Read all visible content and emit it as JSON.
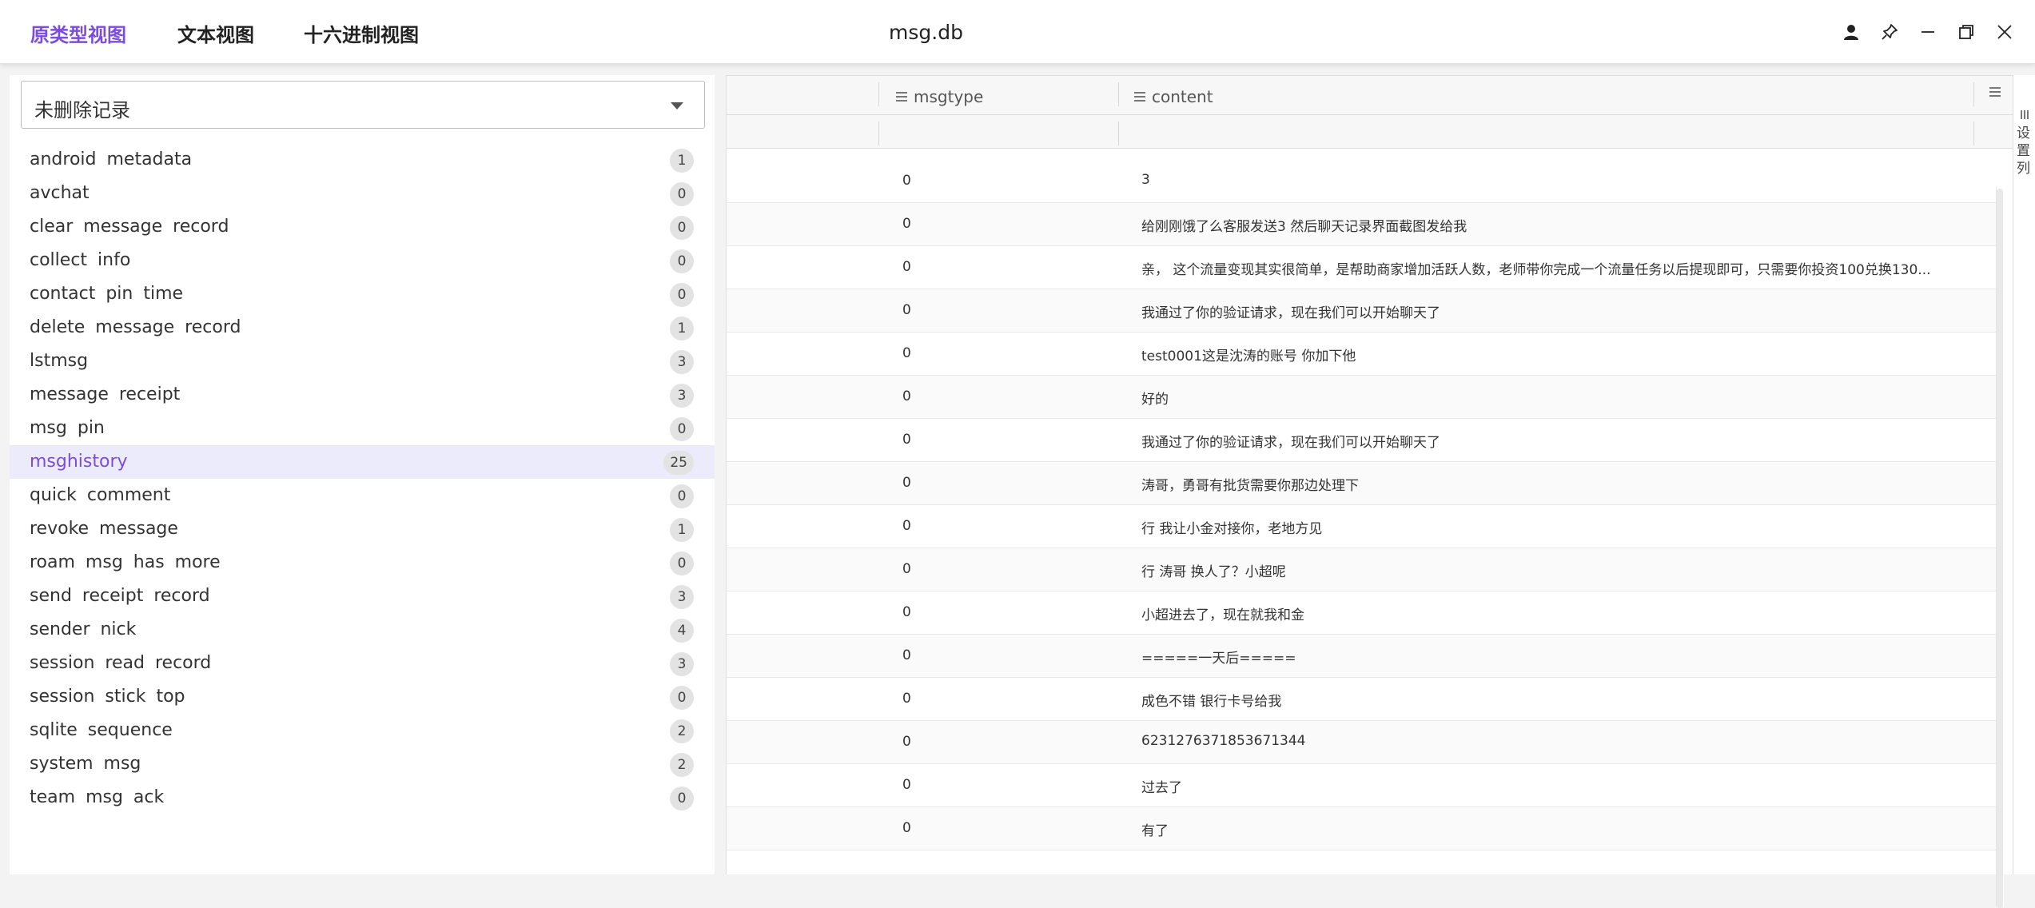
{
  "titlebar": {
    "tabs": [
      {
        "label": "原类型视图",
        "active": true
      },
      {
        "label": "文本视图",
        "active": false
      },
      {
        "label": "十六进制视图",
        "active": false
      }
    ],
    "title": "msg.db",
    "icons": [
      "user-icon",
      "pin-icon",
      "minimize-icon",
      "restore-icon",
      "close-icon"
    ]
  },
  "filter": {
    "selected": "未删除记录"
  },
  "tables": [
    {
      "name": "android metadata",
      "count": "1"
    },
    {
      "name": "avchat",
      "count": "0"
    },
    {
      "name": "clear message record",
      "count": "0"
    },
    {
      "name": "collect info",
      "count": "0"
    },
    {
      "name": "contact pin time",
      "count": "0"
    },
    {
      "name": "delete message record",
      "count": "1"
    },
    {
      "name": "lstmsg",
      "count": "3"
    },
    {
      "name": "message receipt",
      "count": "3"
    },
    {
      "name": "msg pin",
      "count": "0"
    },
    {
      "name": "msghistory",
      "count": "25",
      "selected": true
    },
    {
      "name": "quick comment",
      "count": "0"
    },
    {
      "name": "revoke message",
      "count": "1"
    },
    {
      "name": "roam msg has more",
      "count": "0"
    },
    {
      "name": "send receipt record",
      "count": "3"
    },
    {
      "name": "sender nick",
      "count": "4"
    },
    {
      "name": "session read record",
      "count": "3"
    },
    {
      "name": "session stick top",
      "count": "0"
    },
    {
      "name": "sqlite sequence",
      "count": "2"
    },
    {
      "name": "system msg",
      "count": "2"
    },
    {
      "name": "team msg ack",
      "count": "0"
    }
  ],
  "grid": {
    "columns": {
      "msgtype": "msgtype",
      "content": "content"
    },
    "rows": [
      {
        "msgtype": "0",
        "content": "3"
      },
      {
        "msgtype": "0",
        "content": "给刚刚饿了么客服发送3 然后聊天记录界面截图发给我"
      },
      {
        "msgtype": "0",
        "content": "亲， 这个流量变现其实很简单，是帮助商家增加活跃人数，老师带你完成一个流量任务以后提现即可，只需要你投资100兑换130..."
      },
      {
        "msgtype": "0",
        "content": "我通过了你的验证请求，现在我们可以开始聊天了"
      },
      {
        "msgtype": "0",
        "content": "test0001这是沈涛的账号 你加下他"
      },
      {
        "msgtype": "0",
        "content": "好的"
      },
      {
        "msgtype": "0",
        "content": "我通过了你的验证请求，现在我们可以开始聊天了"
      },
      {
        "msgtype": "0",
        "content": "涛哥，勇哥有批货需要你那边处理下"
      },
      {
        "msgtype": "0",
        "content": "行 我让小金对接你，老地方见"
      },
      {
        "msgtype": "0",
        "content": "行 涛哥 换人了？小超呢"
      },
      {
        "msgtype": "0",
        "content": "小超进去了，现在就我和金"
      },
      {
        "msgtype": "0",
        "content": "=====一天后====="
      },
      {
        "msgtype": "0",
        "content": "成色不错 银行卡号给我"
      },
      {
        "msgtype": "0",
        "content": "6231276371853671344"
      },
      {
        "msgtype": "0",
        "content": "过去了"
      },
      {
        "msgtype": "0",
        "content": "有了"
      }
    ]
  },
  "settings_column": {
    "label": "设置列"
  },
  "colors": {
    "accent": "#7c4ddc",
    "selected_bg": "#ecebfb"
  }
}
